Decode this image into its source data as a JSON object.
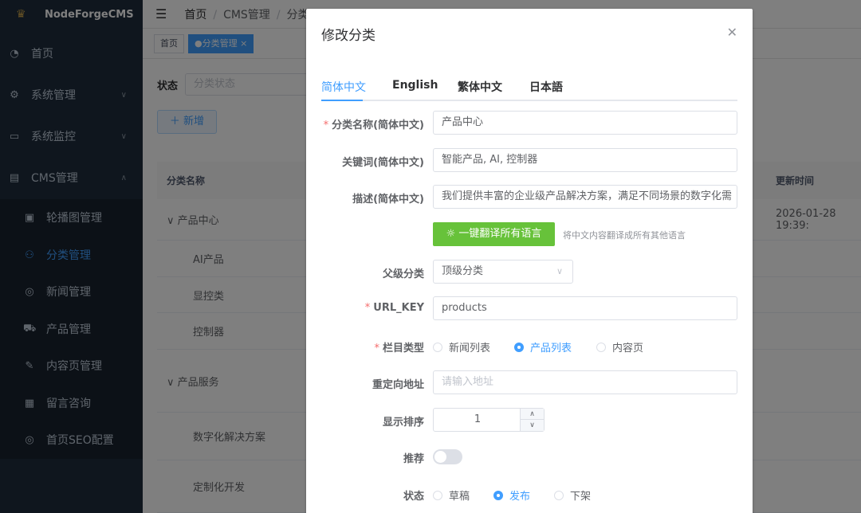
{
  "app": {
    "brand": "NodeForgeCMS"
  },
  "sidebar": {
    "items": [
      {
        "icon": "dashboard-icon",
        "label": "首页"
      },
      {
        "icon": "gear-icon",
        "label": "系统管理"
      },
      {
        "icon": "monitor-icon",
        "label": "系统监控"
      },
      {
        "icon": "document-icon",
        "label": "CMS管理"
      }
    ],
    "sub_items": [
      {
        "icon": "carousel-icon",
        "label": "轮播图管理"
      },
      {
        "icon": "tree-icon",
        "label": "分类管理"
      },
      {
        "icon": "news-icon",
        "label": "新闻管理"
      },
      {
        "icon": "cart-icon",
        "label": "产品管理"
      },
      {
        "icon": "edit-icon",
        "label": "内容页管理"
      },
      {
        "icon": "message-icon",
        "label": "留言咨询"
      },
      {
        "icon": "seo-icon",
        "label": "首页SEO配置"
      }
    ]
  },
  "header": {
    "breadcrumb": [
      "首页",
      "CMS管理",
      "分类"
    ],
    "tags": [
      "首页",
      "●分类管理 ×"
    ]
  },
  "page": {
    "filter_label": "状态",
    "filter_placeholder": "分类状态",
    "add_button": "＋ 新增",
    "table": {
      "col_name": "分类名称",
      "col_updated": "更新时间",
      "rows": [
        {
          "name": "∨  产品中心",
          "updated": "2026-01-28 19:39:"
        },
        {
          "name": "AI产品",
          "updated": ""
        },
        {
          "name": "显控类",
          "updated": ""
        },
        {
          "name": "控制器",
          "updated": ""
        },
        {
          "name": "∨  产品服务",
          "updated": ""
        },
        {
          "name": "数字化解决方案",
          "updated": ""
        },
        {
          "name": "定制化开发",
          "updated": ""
        }
      ]
    }
  },
  "dialog": {
    "title": "修改分类",
    "tabs": [
      "简体中文",
      "English",
      "繁体中文",
      "日本語"
    ],
    "fields": {
      "name_label": "分类名称(简体中文)",
      "name_value": "产品中心",
      "keywords_label": "关键词(简体中文)",
      "keywords_value": "智能产品, AI, 控制器",
      "desc_label": "描述(简体中文)",
      "desc_value": "我们提供丰富的企业级产品解决方案，满足不同场景的数字化需",
      "translate_button": "☼ 一键翻译所有语言",
      "translate_hint": "将中文内容翻译成所有其他语言",
      "parent_label": "父级分类",
      "parent_value": "顶级分类",
      "urlkey_label": "URL_KEY",
      "urlkey_value": "products",
      "type_label": "栏目类型",
      "type_options": [
        "新闻列表",
        "产品列表",
        "内容页"
      ],
      "type_selected": "产品列表",
      "redirect_label": "重定向地址",
      "redirect_placeholder": "请输入地址",
      "sort_label": "显示排序",
      "sort_value": "1",
      "recommend_label": "推荐",
      "recommend_on": false,
      "status_label": "状态",
      "status_options": [
        "草稿",
        "发布",
        "下架"
      ],
      "status_selected": "发布"
    }
  },
  "colors": {
    "accent": "#409eff",
    "success": "#67c23a",
    "sidebar": "#1f2d3d",
    "danger": "#f56c6c"
  }
}
